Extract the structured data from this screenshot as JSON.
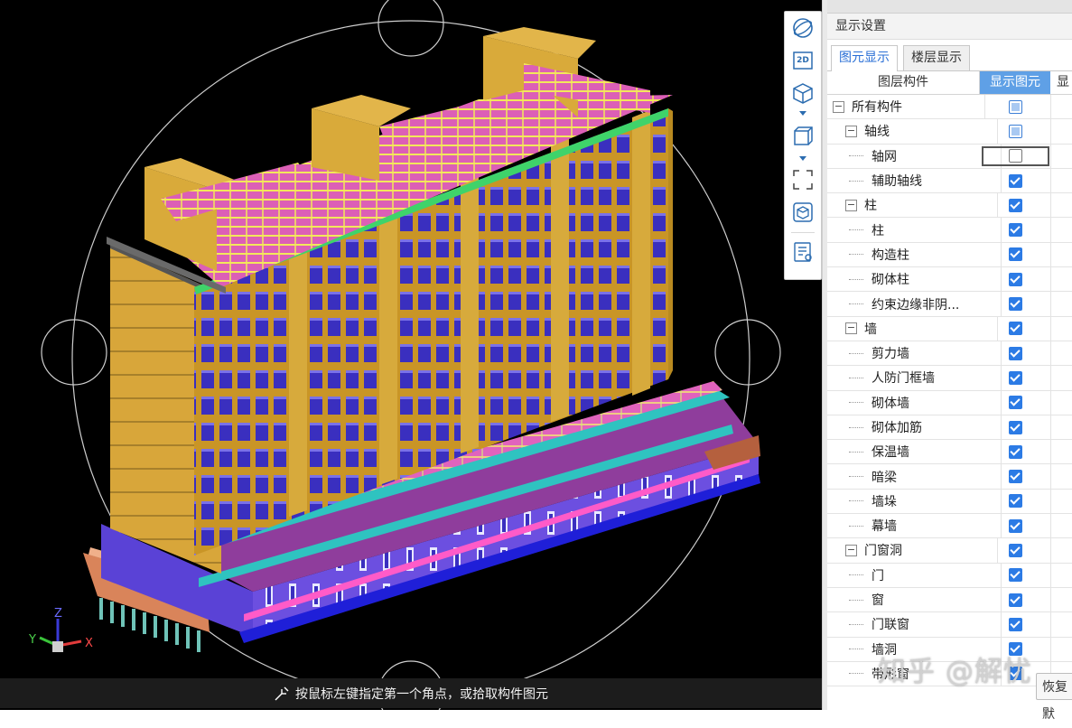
{
  "status": {
    "prompt": "按鼠标左键指定第一个角点，或拾取构件图元"
  },
  "toolbar": {
    "items": [
      "orbit-icon",
      "2d-view-icon",
      "3d-cube-icon",
      "box-view-icon",
      "zoom-extents-icon",
      "dynamic-view-icon",
      "layer-list-icon"
    ],
    "view_2d_label": "2D"
  },
  "axis": {
    "x": "X",
    "y": "Y",
    "z": "Z"
  },
  "panel": {
    "title": "显示设置",
    "tabs": [
      {
        "label": "图元显示",
        "active": true
      },
      {
        "label": "楼层显示",
        "active": false
      }
    ],
    "columns": {
      "name": "图层构件",
      "show": "显示图元",
      "more": "显"
    },
    "rows": [
      {
        "label": "所有构件",
        "level": 0,
        "toggle": "-",
        "state": "partial"
      },
      {
        "label": "轴线",
        "level": 1,
        "toggle": "-",
        "state": "partial"
      },
      {
        "label": "轴网",
        "level": 2,
        "state": "empty",
        "focused": true
      },
      {
        "label": "辅助轴线",
        "level": 2,
        "state": "checked"
      },
      {
        "label": "柱",
        "level": 1,
        "toggle": "-",
        "state": "checked"
      },
      {
        "label": "柱",
        "level": 2,
        "state": "checked"
      },
      {
        "label": "构造柱",
        "level": 2,
        "state": "checked"
      },
      {
        "label": "砌体柱",
        "level": 2,
        "state": "checked"
      },
      {
        "label": "约束边缘非阴...",
        "level": 2,
        "state": "checked"
      },
      {
        "label": "墙",
        "level": 1,
        "toggle": "-",
        "state": "checked"
      },
      {
        "label": "剪力墙",
        "level": 2,
        "state": "checked"
      },
      {
        "label": "人防门框墙",
        "level": 2,
        "state": "checked"
      },
      {
        "label": "砌体墙",
        "level": 2,
        "state": "checked"
      },
      {
        "label": "砌体加筋",
        "level": 2,
        "state": "checked"
      },
      {
        "label": "保温墙",
        "level": 2,
        "state": "checked"
      },
      {
        "label": "暗梁",
        "level": 2,
        "state": "checked"
      },
      {
        "label": "墙垛",
        "level": 2,
        "state": "checked"
      },
      {
        "label": "幕墙",
        "level": 2,
        "state": "checked"
      },
      {
        "label": "门窗洞",
        "level": 1,
        "toggle": "-",
        "state": "checked"
      },
      {
        "label": "门",
        "level": 2,
        "state": "checked"
      },
      {
        "label": "窗",
        "level": 2,
        "state": "checked"
      },
      {
        "label": "门联窗",
        "level": 2,
        "state": "checked"
      },
      {
        "label": "墙洞",
        "level": 2,
        "state": "checked"
      },
      {
        "label": "带形窗",
        "level": 2,
        "state": "checked"
      }
    ],
    "restore_label": "恢复默"
  },
  "watermark": "知乎 @解忧",
  "colors": {
    "viewport_bg": "#000000",
    "building_wall": "#d9aa3a",
    "window": "#3b30c8",
    "slab": "#e05ab8",
    "ledge": "#2fc3c0",
    "accent_blue": "#2c7be5",
    "header_blue": "#5fa0e6"
  }
}
